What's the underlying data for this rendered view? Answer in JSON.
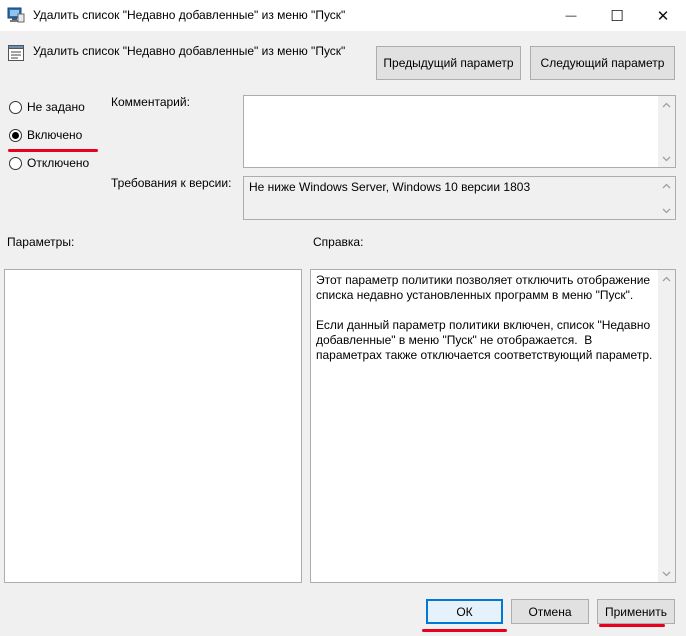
{
  "window": {
    "title": "Удалить список \"Недавно добавленные\" из меню \"Пуск\"",
    "minimize_glyph": "—",
    "maximize_glyph": "☐",
    "close_glyph": "✕"
  },
  "policy": {
    "name": "Удалить список \"Недавно добавленные\" из меню \"Пуск\"",
    "prev_button": "Предыдущий параметр",
    "next_button": "Следующий параметр"
  },
  "state": {
    "options": [
      {
        "label": "Не задано",
        "selected": false
      },
      {
        "label": "Включено",
        "selected": true
      },
      {
        "label": "Отключено",
        "selected": false
      }
    ]
  },
  "comment": {
    "label": "Комментарий:",
    "value": ""
  },
  "supported": {
    "label": "Требования к версии:",
    "value": "Не ниже Windows Server, Windows 10 версии 1803"
  },
  "options_panel": {
    "label": "Параметры:"
  },
  "help_panel": {
    "label": "Справка:",
    "text": "Этот параметр политики позволяет отключить отображение списка недавно установленных программ в меню \"Пуск\".\n\nЕсли данный параметр политики включен, список \"Недавно добавленные\" в меню \"Пуск\" не отображается.  В параметрах также отключается соответствующий параметр."
  },
  "footer": {
    "ok": "ОК",
    "cancel": "Отмена",
    "apply": "Применить"
  },
  "colors": {
    "highlight_underline": "#e8001c",
    "accent": "#0078d7"
  },
  "icons": {
    "title": "policy-window-icon",
    "policy": "policy-setting-icon",
    "scroll_up": "chevron-up-icon",
    "scroll_down": "chevron-down-icon"
  }
}
